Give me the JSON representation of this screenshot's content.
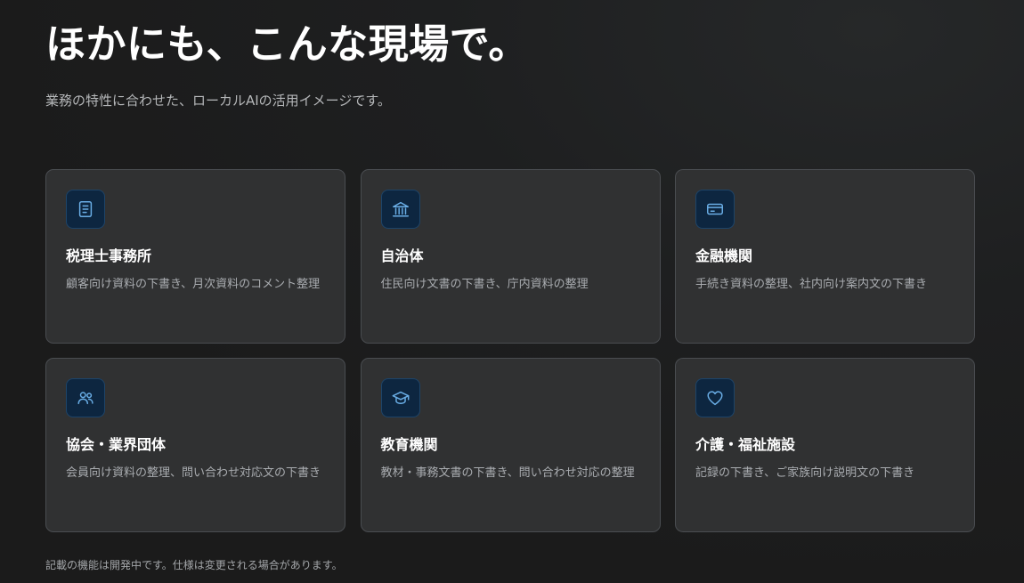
{
  "section": {
    "title": "ほかにも、こんな現場で。",
    "subtitle": "業務の特性に合わせた、ローカルAIの活用イメージです。",
    "note": "記載の機能は開発中です。仕様は変更される場合があります。"
  },
  "cards": [
    {
      "icon": "document-icon",
      "title": "税理士事務所",
      "description": "顧客向け資料の下書き、月次資料のコメント整理"
    },
    {
      "icon": "government-building-icon",
      "title": "自治体",
      "description": "住民向け文書の下書き、庁内資料の整理"
    },
    {
      "icon": "credit-card-icon",
      "title": "金融機関",
      "description": "手続き資料の整理、社内向け案内文の下書き"
    },
    {
      "icon": "users-icon",
      "title": "協会・業界団体",
      "description": "会員向け資料の整理、問い合わせ対応文の下書き"
    },
    {
      "icon": "graduation-cap-icon",
      "title": "教育機関",
      "description": "教材・事務文書の下書き、問い合わせ対応の整理"
    },
    {
      "icon": "heart-icon",
      "title": "介護・福祉施設",
      "description": "記録の下書き、ご家族向け説明文の下書き"
    }
  ],
  "colors": {
    "background": "#1b1b1b",
    "card": "#303132",
    "card_border": "#4a4d51",
    "icon_bg": "#0d2640",
    "icon_stroke": "#6aaee6"
  }
}
